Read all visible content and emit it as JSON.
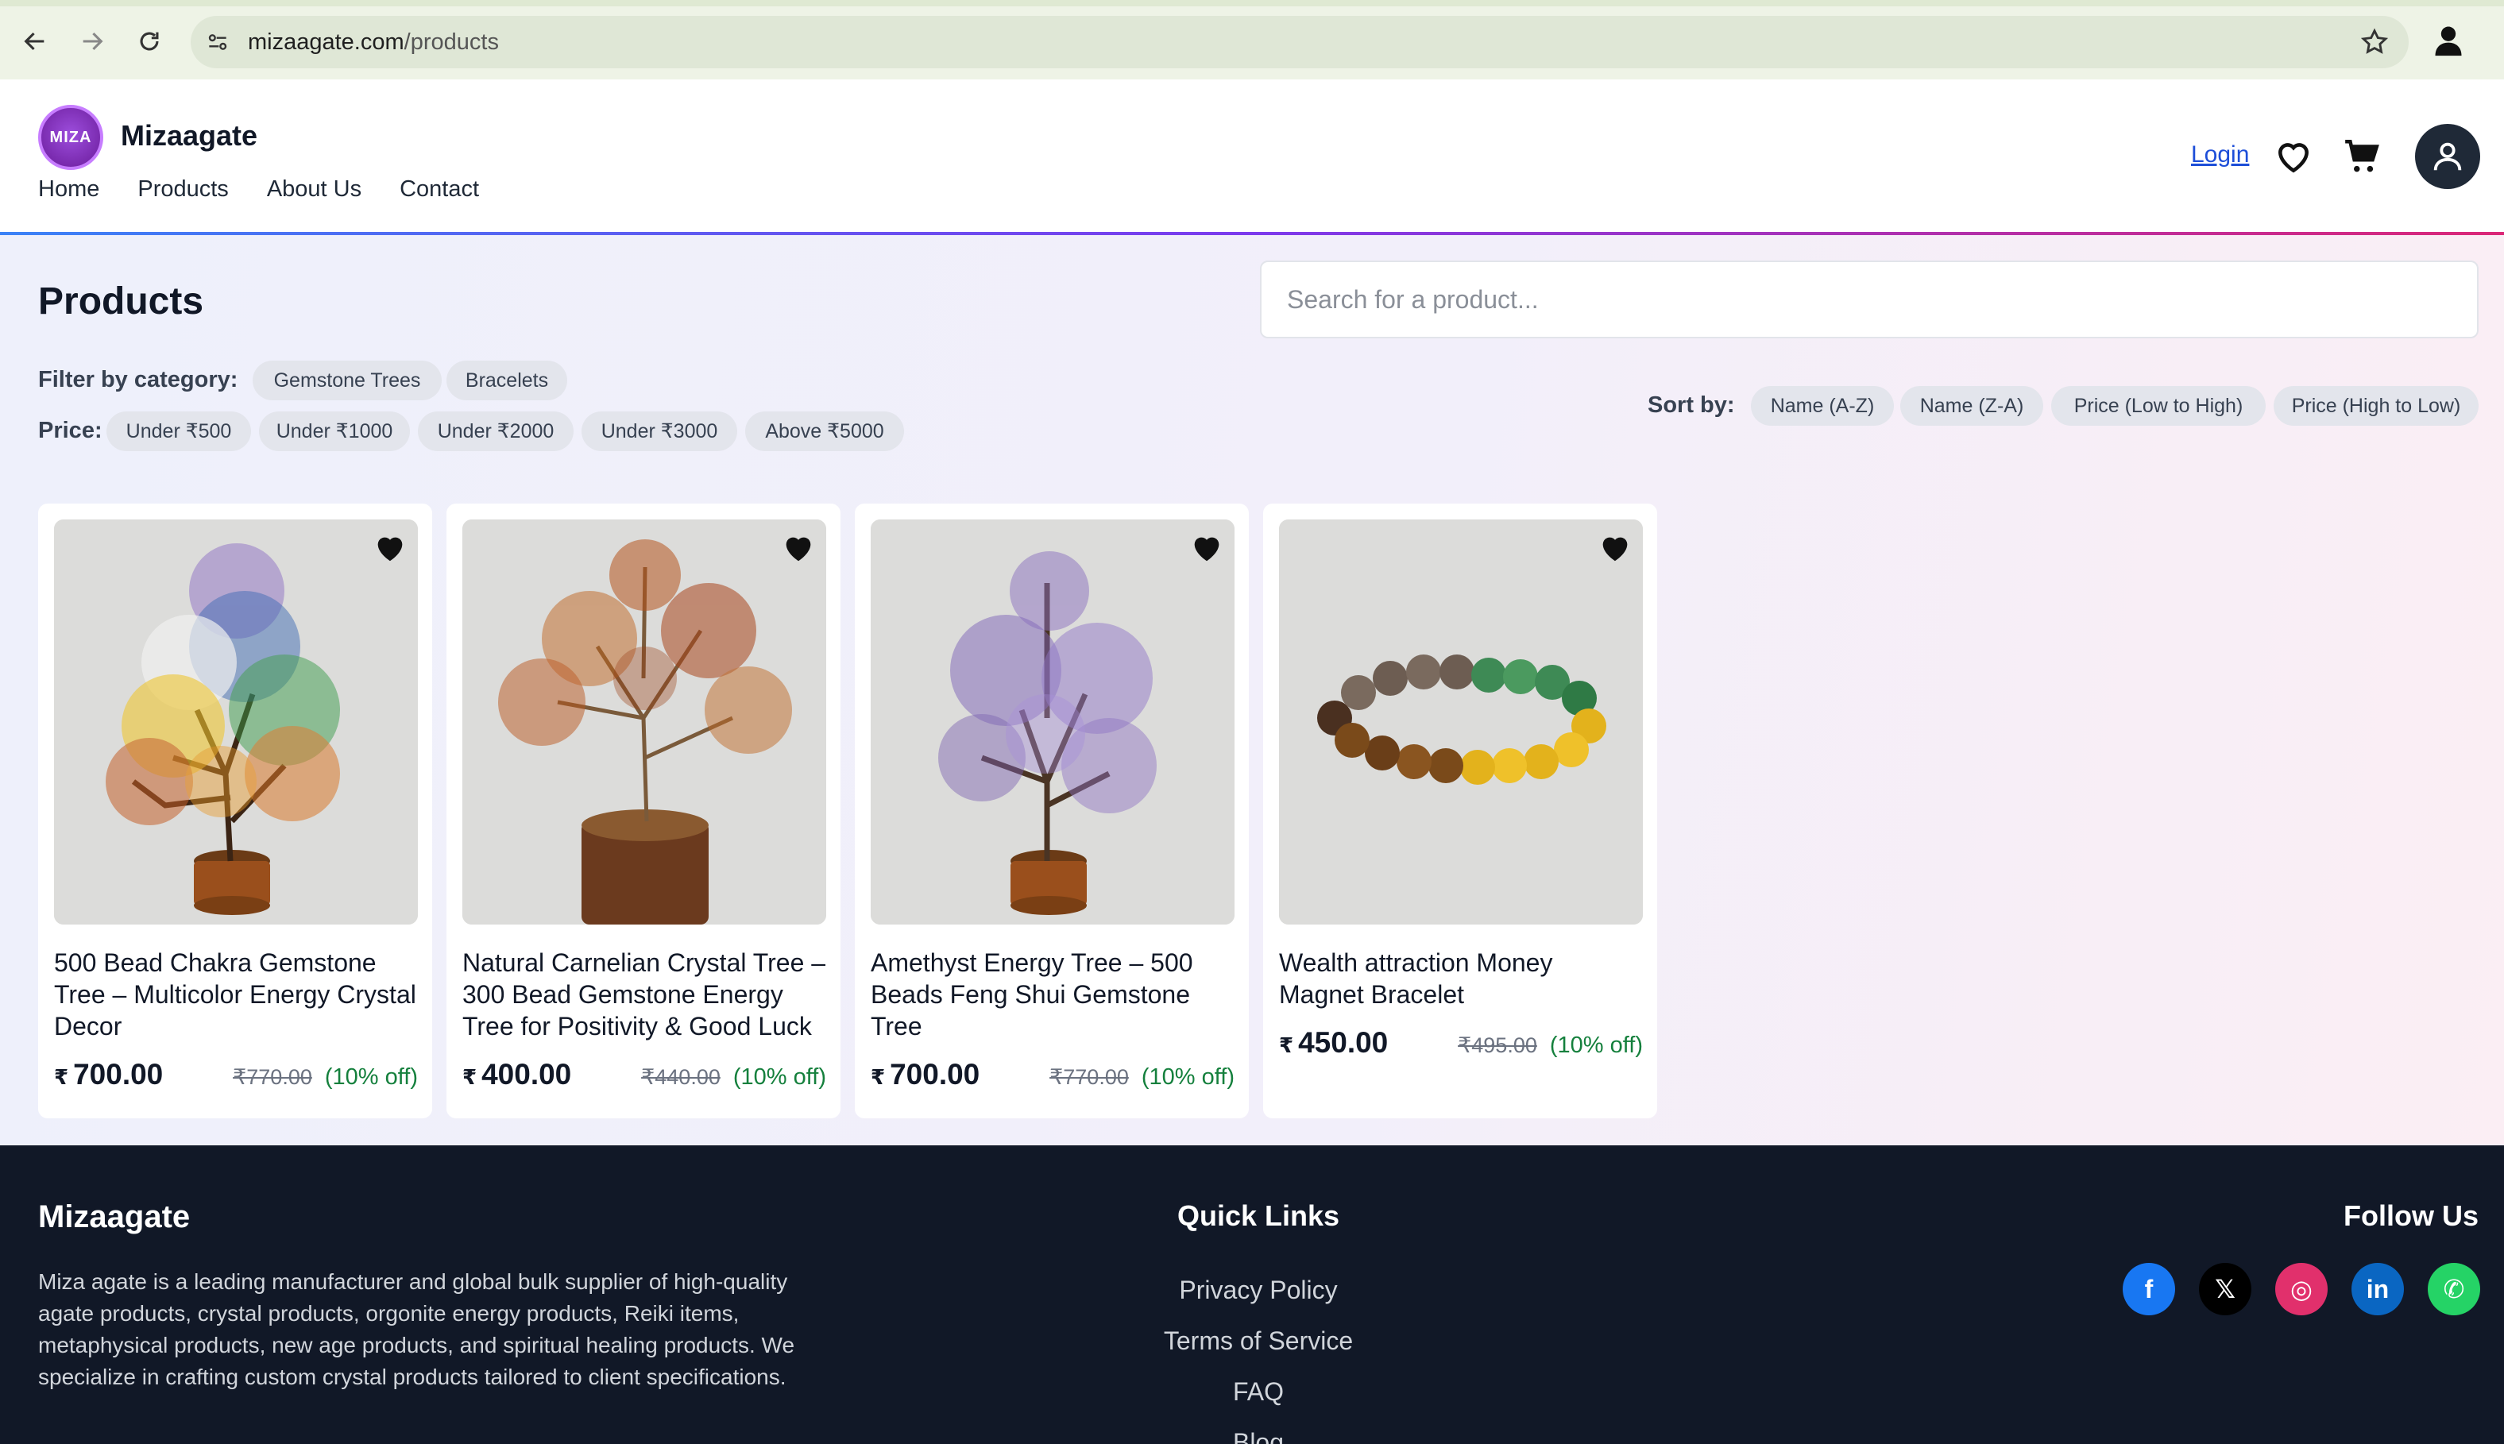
{
  "browser": {
    "url_domain": "mizaagate.com",
    "url_path": "/products"
  },
  "header": {
    "logo_text": "MIZA",
    "brand": "Mizaagate",
    "nav": [
      "Home",
      "Products",
      "About Us",
      "Contact"
    ],
    "login": "Login"
  },
  "main": {
    "title": "Products",
    "search_placeholder": "Search for a product...",
    "filter_label": "Filter by category:",
    "categories": [
      "Gemstone Trees",
      "Bracelets"
    ],
    "price_label": "Price:",
    "price_filters": [
      "Under ₹500",
      "Under ₹1000",
      "Under ₹2000",
      "Under ₹3000",
      "Above ₹5000"
    ],
    "sort_label": "Sort by:",
    "sort_options": [
      "Name (A-Z)",
      "Name (Z-A)",
      "Price (Low to High)",
      "Price (High to Low)"
    ]
  },
  "products": [
    {
      "title": "500 Bead Chakra Gemstone Tree – Multicolor Energy Crystal Decor",
      "rupee": "₹",
      "price": "700.00",
      "mrp": "₹770.00",
      "discount": "(10% off)"
    },
    {
      "title": "Natural Carnelian Crystal Tree – 300 Bead Gemstone Energy Tree for Positivity & Good Luck",
      "rupee": "₹",
      "price": "400.00",
      "mrp": "₹440.00",
      "discount": "(10% off)"
    },
    {
      "title": "Amethyst Energy Tree – 500 Beads Feng Shui Gemstone Tree",
      "rupee": "₹",
      "price": "700.00",
      "mrp": "₹770.00",
      "discount": "(10% off)"
    },
    {
      "title": "Wealth attraction Money Magnet Bracelet",
      "rupee": "₹",
      "price": "450.00",
      "mrp": "₹495.00",
      "discount": "(10% off)"
    }
  ],
  "footer": {
    "brand": "Mizaagate",
    "description": "Miza agate is a leading manufacturer and global bulk supplier of high-quality agate products, crystal products, orgonite energy products, Reiki items, metaphysical products, new age products, and spiritual healing products. We specialize in crafting custom crystal products tailored to client specifications.",
    "quick_links_title": "Quick Links",
    "quick_links": [
      "Privacy Policy",
      "Terms of Service",
      "FAQ",
      "Blog"
    ],
    "follow_title": "Follow Us",
    "socials": [
      {
        "icon": "facebook-icon",
        "glyph": "f",
        "color": "#1877f2"
      },
      {
        "icon": "x-icon",
        "glyph": "𝕏",
        "color": "#000000"
      },
      {
        "icon": "instagram-icon",
        "glyph": "◎",
        "color": "#e1306c"
      },
      {
        "icon": "linkedin-icon",
        "glyph": "in",
        "color": "#0a66c2"
      },
      {
        "icon": "whatsapp-icon",
        "glyph": "✆",
        "color": "#25d366"
      }
    ]
  },
  "colors": {
    "accent_gradient": [
      "#3b82f6",
      "#7c3aed",
      "#db2777"
    ],
    "discount": "#15803d",
    "footer_bg": "#111827"
  }
}
